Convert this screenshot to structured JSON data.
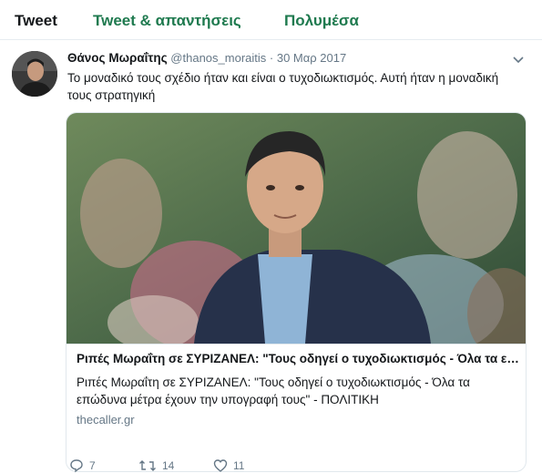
{
  "tabs": [
    {
      "label": "Tweet"
    },
    {
      "label": "Tweet & απαντήσεις"
    },
    {
      "label": "Πολυμέσα"
    }
  ],
  "tweet": {
    "author_name": "Θάνος Μωραΐτης",
    "handle": "@thanos_moraitis",
    "separator": "·",
    "date": "30 Μαρ 2017",
    "text": "Το μοναδικό τους σχέδιο ήταν και είναι ο τυχοδιωκτισμός. Αυτή ήταν η μοναδική τους στρατηγική",
    "card": {
      "title": "Ριπές Μωραΐτη σε ΣΥΡΙΖΑΝΕΛ: \"Τους οδηγεί ο τυχοδιωκτισμός - Όλα τα επώδυνα μέτρα έχουν την υπογραφή τους\" - ΠΟΛΙΤΙΚΗ",
      "description": "Ριπές Μωραΐτη σε ΣΥΡΙΖΑΝΕΛ: \"Τους οδηγεί ο τυχοδιωκτισμός - Όλα τα επώδυνα μέτρα έχουν την υπογραφή τους\" - ΠΟΛΙΤΙΚΗ",
      "domain": "thecaller.gr"
    },
    "actions": {
      "replies": "7",
      "retweets": "14",
      "likes": "11"
    }
  },
  "icons": {
    "caret": "chevron-down-icon",
    "reply": "reply-icon",
    "retweet": "retweet-icon",
    "like": "heart-icon"
  },
  "colors": {
    "tab_active": "#14171a",
    "tab_inactive": "#1f7a4f",
    "secondary_text": "#657786",
    "border": "#e1e8ed"
  }
}
